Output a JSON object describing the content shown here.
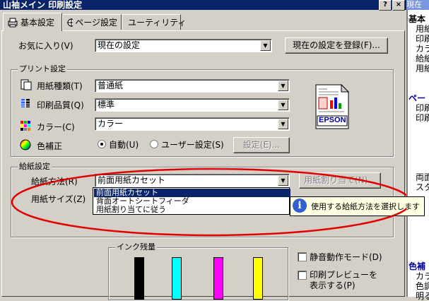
{
  "window": {
    "title": "山袖メイン 印刷設定",
    "help_btn": "?",
    "close_btn": "×"
  },
  "right_panel": {
    "header": "現在",
    "lines": [
      "基本",
      "用紙",
      "印刷",
      "カラ",
      "給紙",
      "用紙",
      "ペー",
      "印刷",
      "印刷",
      "両面",
      "スタ",
      "色補",
      "カラ",
      "色調",
      "明る"
    ]
  },
  "tabs": [
    {
      "label": "基本設定",
      "icon": "printer-icon"
    },
    {
      "label": "ページ設定",
      "icon": "page-setup-icon"
    },
    {
      "label": "ユーティリティ",
      "icon": "utility-icon"
    }
  ],
  "favorites": {
    "label": "お気に入り(V)",
    "value": "現在の設定",
    "register_button": "現在の設定を登録(F)..."
  },
  "print_settings": {
    "title": "プリント設定",
    "paper_type": {
      "label": "用紙種類(T)",
      "value": "普通紙"
    },
    "quality": {
      "label": "印刷品質(Q)",
      "value": "標準"
    },
    "color": {
      "label": "カラー(C)",
      "value": "カラー"
    },
    "color_correction": {
      "label": "色補正",
      "auto": "自動(U)",
      "user": "ユーザー設定(S)",
      "settings_button": "設定(E)..."
    },
    "brand": "EPSON"
  },
  "feed": {
    "title": "給紙設定",
    "method_label": "給紙方法(R)",
    "method_value": "前面用紙カセット",
    "paper_size_label": "用紙サイズ(Z)",
    "assign_button": "用紙割り当て(N)...",
    "options": [
      "前面用紙カセット",
      "背面オートシートフィーダ",
      "用紙割り当てに従う"
    ]
  },
  "tooltip": "使用する給紙方法を選択します",
  "ink": {
    "title": "インク残量",
    "colors": [
      "#000000",
      "#00ffff",
      "#ff00ff",
      "#ffff00"
    ],
    "levels": [
      1,
      1,
      1,
      1
    ]
  },
  "options": {
    "quiet": "静音動作モード(D)",
    "preview_line1": "印刷プレビューを",
    "preview_line2": "表示する(P)"
  },
  "highlight_color": "#e00000"
}
